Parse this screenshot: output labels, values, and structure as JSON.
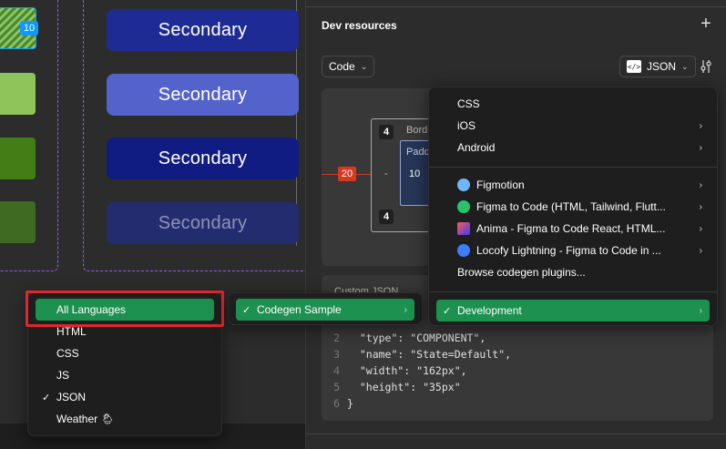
{
  "canvas": {
    "badge": "10",
    "secondary_buttons": [
      "Secondary",
      "Secondary",
      "Secondary",
      "Secondary"
    ]
  },
  "colors": {
    "sec_btn_1": "#1f2b94",
    "sec_btn_2": "#5463cc",
    "sec_btn_3": "#111c82",
    "sec_btn_4": "#232c6e",
    "green_1": "#8fc45a",
    "green_2": "#447d16",
    "green_3": "#3f6a21",
    "accent_green": "#1d9150",
    "highlight_red": "#e1262c"
  },
  "panel": {
    "title": "Dev resources",
    "plus_icon": "plus-icon",
    "code_select": "Code",
    "lang_select": "JSON",
    "box_model": {
      "border_label": "Bord",
      "padding_label": "Padd",
      "margin_left": "20",
      "border_top": "4",
      "border_bottom": "4",
      "border_left": "-",
      "padding_left": "10"
    },
    "code_header": "Custom JSON",
    "code_lines": [
      {
        "n": "2",
        "text": "  \"type\": \"COMPONENT\","
      },
      {
        "n": "3",
        "text": "  \"name\": \"State=Default\","
      },
      {
        "n": "4",
        "text": "  \"width\": \"162px\","
      },
      {
        "n": "5",
        "text": "  \"height\": \"35px\""
      },
      {
        "n": "6",
        "text": "}"
      }
    ]
  },
  "menu_languages": {
    "items": [
      "All Languages",
      "HTML",
      "CSS",
      "JS",
      "JSON",
      "Weather 🌦"
    ],
    "checked": "JSON",
    "highlighted": "All Languages"
  },
  "menu_codegen": {
    "item": "Codegen Sample"
  },
  "menu_plugins": {
    "items": [
      "CSS",
      "iOS",
      "Android"
    ],
    "plugins": [
      "Figmotion",
      "Figma to Code (HTML, Tailwind, Flutt...",
      "Anima - Figma to Code React, HTML...",
      "Locofy Lightning - Figma to Code in ..."
    ],
    "browse": "Browse codegen plugins...",
    "development": "Development"
  }
}
